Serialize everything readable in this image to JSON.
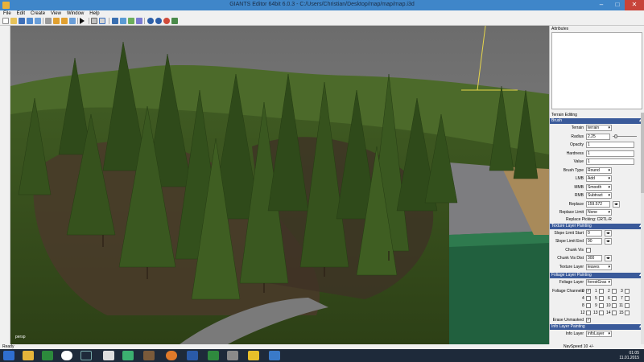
{
  "window": {
    "title": "GIANTS Editor 64bit 6.0.3 - C:/Users/Christian/Desktop/map/map/map.i3d"
  },
  "menu": [
    "File",
    "Edit",
    "Create",
    "View",
    "Window",
    "Help"
  ],
  "viewport": {
    "label": "persp"
  },
  "panels": {
    "attributes_title": "Attributes",
    "terrain_editing_title": "Terrain Editing",
    "brush": {
      "header": "Brush",
      "terrain_label": "Terrain",
      "terrain_value": "terrain",
      "radius_label": "Radius",
      "radius_value": "2.25",
      "opacity_label": "Opacity",
      "opacity_value": "1",
      "hardness_label": "Hardness",
      "hardness_value": "1",
      "value_label": "Value",
      "value_value": "1",
      "brush_type_label": "Brush Type",
      "brush_type_value": "Round",
      "lmb_label": "LMB",
      "lmb_value": "Add",
      "mmb_label": "MMB",
      "mmb_value": "Smooth",
      "rmb_label": "RMB",
      "rmb_value": "Subtract",
      "replace_label": "Replace",
      "replace_value": "159.572",
      "replace_limit_label": "Replace Limit",
      "replace_limit_value": "None",
      "replace_picking": "Replace Picking: CRTL-R"
    },
    "texture": {
      "header": "Texture Layer Painting",
      "slope_start_label": "Slope Limit Start",
      "slope_start_value": "0",
      "slope_end_label": "Slope Limit End",
      "slope_end_value": "90",
      "chunk_vis_label": "Chunk Vis",
      "chunk_vis_dist_label": "Chunk Vis Dist",
      "chunk_vis_dist_value": "300",
      "texture_layer_label": "Texture Layer",
      "texture_layer_value": "leaves"
    },
    "foliage": {
      "header": "Foliage Layer Painting",
      "foliage_layer_label": "Foliage Layer",
      "foliage_layer_value": "forestGras",
      "foliage_channels_label": "Foliage Channels",
      "channels": [
        "0",
        "1",
        "2",
        "3",
        "4",
        "5",
        "6",
        "7",
        "8",
        "9",
        "10",
        "11",
        "12",
        "13",
        "14",
        "15"
      ],
      "erase_unmasked_label": "Erase Unmasked"
    },
    "info": {
      "header": "Info Layer Painting",
      "info_layer_label": "Info Layer",
      "info_layer_value": "infoLayer"
    }
  },
  "statusbar": {
    "left": "Ready",
    "right": "NavSpeed 10 +/-"
  },
  "taskbar": {
    "time": "01:05",
    "date": "11.01.2015"
  }
}
